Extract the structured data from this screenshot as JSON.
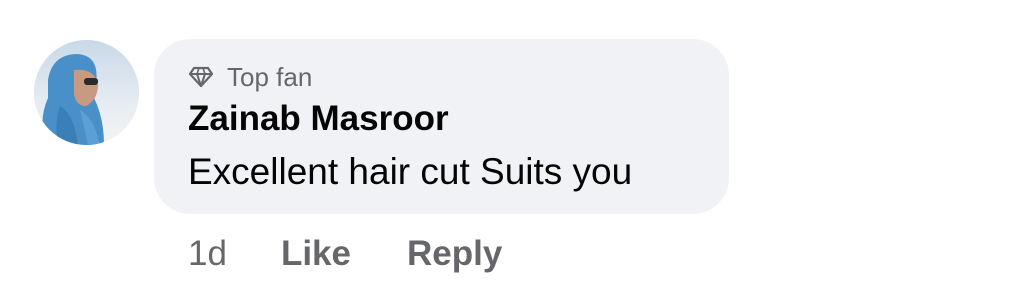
{
  "comment": {
    "badge": {
      "label": "Top fan",
      "icon": "diamond-icon"
    },
    "author": "Zainab Masroor",
    "text": "Excellent hair cut Suits you",
    "timestamp": "1d",
    "actions": {
      "like_label": "Like",
      "reply_label": "Reply"
    }
  },
  "colors": {
    "bubble_background": "#f0f2f5",
    "primary_text": "#050505",
    "secondary_text": "#65676b",
    "avatar_scarf": "#4a90c8"
  }
}
